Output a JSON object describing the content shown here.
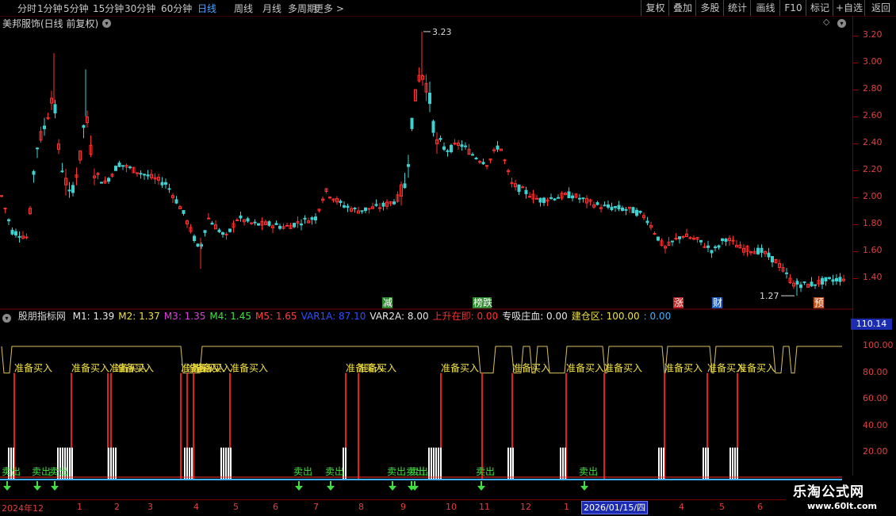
{
  "toolbar": {
    "periods": [
      "分时",
      "1分钟",
      "5分钟",
      "15分钟",
      "30分钟",
      "60分钟",
      "日线",
      "周线",
      "月线",
      "多周期",
      "更多 >"
    ],
    "active_period": "日线",
    "actions": [
      "复权",
      "叠加",
      "多股",
      "统计",
      "画线",
      "F10",
      "标记",
      "+自选",
      "返回"
    ]
  },
  "stock": {
    "title": "美邦服饰(日线 前复权)"
  },
  "price_axis": {
    "labels": [
      "3.20",
      "3.00",
      "2.80",
      "2.60",
      "2.40",
      "2.20",
      "2.00",
      "1.80",
      "1.60",
      "1.40"
    ]
  },
  "annotations": {
    "high": "3.23",
    "low": "1.27"
  },
  "event_markers": [
    {
      "label": "减",
      "color": "#2e8b2e"
    },
    {
      "label": "榜跌",
      "color": "#2e8b2e"
    },
    {
      "label": "涨",
      "color": "#c02020"
    },
    {
      "label": "财",
      "color": "#1e5fbf"
    },
    {
      "label": "预",
      "color": "#c05020"
    }
  ],
  "indicator": {
    "name": "股朋指标网",
    "fields": [
      {
        "text": "M1: 1.39",
        "color": "#e8e8e8"
      },
      {
        "text": "M2: 1.37",
        "color": "#f0e040"
      },
      {
        "text": "M3: 1.35",
        "color": "#e040e0"
      },
      {
        "text": "M4: 1.45",
        "color": "#40e040"
      },
      {
        "text": "M5: 1.65",
        "color": "#ff4040"
      },
      {
        "text": "VAR1A: 87.10",
        "color": "#3050ff"
      },
      {
        "text": "VAR2A: 8.00",
        "color": "#e8e8e8"
      },
      {
        "text": "上升在即: 0.00",
        "color": "#ff3030"
      },
      {
        "text": "专吸庄血: 0.00",
        "color": "#e8e8e8"
      },
      {
        "text": "建仓区: 100.00",
        "color": "#f0e040"
      },
      {
        "text": ": 0.00",
        "color": "#40b0ff"
      }
    ],
    "current_value": "110.14",
    "axis_labels": [
      "100.00",
      "80.00",
      "60.00",
      "40.00",
      "20.00"
    ],
    "buy_label": "准备买入",
    "sell_label": "卖出"
  },
  "time_axis": {
    "ticks": [
      "2024年12",
      "1",
      "2",
      "3",
      "4",
      "5",
      "6",
      "7",
      "8",
      "9",
      "10",
      "11",
      "12",
      "1",
      "4",
      "5",
      "6"
    ],
    "selected_date": "2026/01/15/四"
  },
  "watermark": {
    "cn": "乐淘公式网",
    "url": "www.60lt.com"
  }
}
